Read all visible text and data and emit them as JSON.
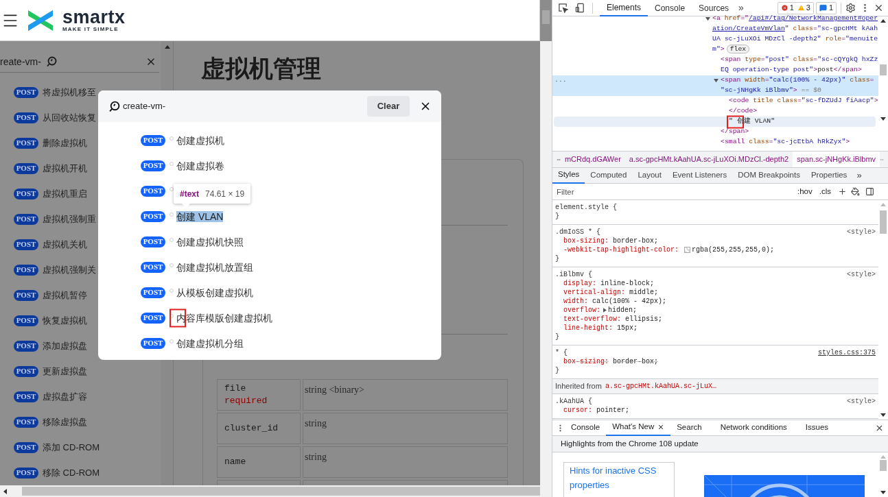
{
  "page": {
    "header": {
      "logo": {
        "name": "smartx",
        "tagline": "MAKE IT SIMPLE"
      }
    },
    "sidebar": {
      "search": {
        "value": "reate-vm-"
      },
      "items": [
        {
          "method": "POST",
          "label": "将虚拟机移至"
        },
        {
          "method": "POST",
          "label": "从回收站恢复"
        },
        {
          "method": "POST",
          "label": "删除虚拟机"
        },
        {
          "method": "POST",
          "label": "虚拟机开机"
        },
        {
          "method": "POST",
          "label": "虚拟机重启"
        },
        {
          "method": "POST",
          "label": "虚拟机强制重"
        },
        {
          "method": "POST",
          "label": "虚拟机关机"
        },
        {
          "method": "POST",
          "label": "虚拟机强制关"
        },
        {
          "method": "POST",
          "label": "虚拟机暂停"
        },
        {
          "method": "POST",
          "label": "恢复虚拟机"
        },
        {
          "method": "POST",
          "label": "添加虚拟盘"
        },
        {
          "method": "POST",
          "label": "更新虚拟盘"
        },
        {
          "method": "POST",
          "label": "虚拟盘扩容"
        },
        {
          "method": "POST",
          "label": "移除虚拟盘"
        },
        {
          "method": "POST",
          "label": "添加 CD-ROM"
        },
        {
          "method": "POST",
          "label": "移除 CD-ROM"
        }
      ]
    },
    "main": {
      "title": "虚拟机管理",
      "table": {
        "rows": [
          {
            "name": "file",
            "required": "required",
            "type": "string <binary>"
          },
          {
            "name": "cluster_id",
            "type": "string"
          },
          {
            "name": "name",
            "type": "string"
          }
        ]
      }
    },
    "search_modal": {
      "query": "create-vm-",
      "clear_button": "Clear",
      "results": [
        {
          "method": "POST",
          "label": "创建虚拟机",
          "highlighted": false,
          "marked": false
        },
        {
          "method": "POST",
          "label": "创建虚拟卷",
          "highlighted": false,
          "marked": false
        },
        {
          "method": "POST"
        },
        {
          "method": "POST",
          "label": "创建 VLAN",
          "highlighted": true,
          "marked": false
        },
        {
          "method": "POST",
          "label": "创建虚拟机快照",
          "highlighted": false,
          "marked": false
        },
        {
          "method": "POST",
          "label": "创建虚拟机放置组",
          "highlighted": false,
          "marked": false
        },
        {
          "method": "POST",
          "label": "从模板创建虚拟机",
          "highlighted": false,
          "marked": false
        },
        {
          "method": "POST",
          "label": "内容库模版创建虚拟机",
          "highlighted": false,
          "marked": true
        },
        {
          "method": "POST",
          "label": "创建虚拟机分组",
          "highlighted": false,
          "marked": false
        }
      ]
    },
    "tooltip": {
      "node": "#text",
      "size": "74.61 × 19"
    }
  },
  "devtools": {
    "toolbar": {
      "tabs": [
        {
          "label": "Elements",
          "selected": true
        },
        {
          "label": "Console",
          "selected": false
        },
        {
          "label": "Sources",
          "selected": false
        }
      ],
      "more": "»",
      "errors": "1",
      "warnings": "3",
      "messages": "1"
    },
    "elements": {
      "tree": [
        {
          "kind": "parent",
          "expanded": true,
          "selected": false,
          "hovered": false,
          "marked": false,
          "lines": [
            [
              {
                "kind": "tag",
                "text": "<a "
              },
              {
                "kind": "attr",
                "text": "href"
              },
              {
                "kind": "tag",
                "text": "=\""
              },
              {
                "kind": "link",
                "text": "/api#/tag/NetworkManagement#oper"
              }
            ],
            [
              {
                "kind": "link",
                "text": "ation/CreateVmVlan"
              },
              {
                "kind": "value",
                "text": "\" "
              },
              {
                "kind": "attr",
                "text": "class"
              },
              {
                "kind": "tag",
                "text": "="
              },
              {
                "kind": "value",
                "text": "\"sc-gpcHMt kAah"
              }
            ],
            [
              {
                "kind": "value",
                "text": "UA sc-jLuXOi MDzCl -depth2\" "
              },
              {
                "kind": "attr",
                "text": "role"
              },
              {
                "kind": "tag",
                "text": "="
              },
              {
                "kind": "value",
                "text": "\"menuite"
              }
            ],
            [
              {
                "kind": "value",
                "text": "m\""
              },
              {
                "kind": "tag",
                "text": ">"
              },
              {
                "kind": "badge",
                "text": "flex"
              }
            ]
          ],
          "children": [
            {
              "kind": "leaf",
              "selected": false,
              "hovered": false,
              "marked": false,
              "lines": [
                [
                  {
                    "kind": "tag",
                    "text": "<span "
                  },
                  {
                    "kind": "attr",
                    "text": "type"
                  },
                  {
                    "kind": "tag",
                    "text": "="
                  },
                  {
                    "kind": "value",
                    "text": "\"post\" "
                  },
                  {
                    "kind": "attr",
                    "text": "class"
                  },
                  {
                    "kind": "tag",
                    "text": "="
                  },
                  {
                    "kind": "value",
                    "text": "\"sc-cQYgkQ hxZz"
                  }
                ],
                [
                  {
                    "kind": "value",
                    "text": "EQ operation-type post\""
                  },
                  {
                    "kind": "tag",
                    "text": ">"
                  },
                  {
                    "kind": "text",
                    "text": "post"
                  },
                  {
                    "kind": "tag",
                    "text": "</span>"
                  }
                ]
              ]
            },
            {
              "kind": "parent",
              "expanded": true,
              "selected": true,
              "hovered": false,
              "marked": false,
              "gutter": "...",
              "lines": [
                [
                  {
                    "kind": "tag",
                    "text": "<span "
                  },
                  {
                    "kind": "attr",
                    "text": "width"
                  },
                  {
                    "kind": "tag",
                    "text": "="
                  },
                  {
                    "kind": "value",
                    "text": "\"calc(100% - 42px)\" "
                  },
                  {
                    "kind": "attr",
                    "text": "class"
                  },
                  {
                    "kind": "tag",
                    "text": "="
                  }
                ],
                [
                  {
                    "kind": "value",
                    "text": "\"sc-jNHgKk iBlbmv\""
                  },
                  {
                    "kind": "tag",
                    "text": ">"
                  },
                  {
                    "kind": "ref",
                    "text": " == $0"
                  }
                ]
              ],
              "children": [
                {
                  "kind": "leaf",
                  "selected": false,
                  "hovered": false,
                  "marked": false,
                  "lines": [
                    [
                      {
                        "kind": "tag",
                        "text": "<code "
                      },
                      {
                        "kind": "attr",
                        "text": "title "
                      },
                      {
                        "kind": "attr",
                        "text": "class"
                      },
                      {
                        "kind": "tag",
                        "text": "="
                      },
                      {
                        "kind": "value",
                        "text": "\"sc-fDZUdJ fiAacp\""
                      },
                      {
                        "kind": "tag",
                        "text": ">"
                      }
                    ],
                    [
                      {
                        "kind": "tag",
                        "text": "</code>"
                      }
                    ]
                  ]
                },
                {
                  "kind": "leaf",
                  "selected": false,
                  "hovered": true,
                  "marked": true,
                  "lines": [
                    [
                      {
                        "kind": "text",
                        "text": "\" 创建 VLAN\""
                      }
                    ]
                  ]
                }
              ],
              "closing": [
                [
                  {
                    "kind": "tag",
                    "text": "</span>"
                  }
                ]
              ]
            },
            {
              "kind": "leaf",
              "selected": false,
              "hovered": false,
              "marked": false,
              "lines": [
                [
                  {
                    "kind": "tag",
                    "text": "<small "
                  },
                  {
                    "kind": "attr",
                    "text": "class"
                  },
                  {
                    "kind": "tag",
                    "text": "="
                  },
                  {
                    "kind": "value",
                    "text": "\"sc-jcEtbA hRkZyx\""
                  },
                  {
                    "kind": "tag",
                    "text": ">"
                  }
                ]
              ]
            }
          ]
        }
      ]
    },
    "breadcrumbs": [
      {
        "label": "mCRdq.dGAWer",
        "selected": false
      },
      {
        "label": "a.sc-gpcHMt.kAahUA.sc-jLuXOi.MDzCl.-depth2",
        "selected": false
      },
      {
        "label": "span.sc-jNHgKk.iBlbmv",
        "selected": true
      }
    ],
    "styles_tabs": [
      {
        "label": "Styles",
        "selected": true
      },
      {
        "label": "Computed",
        "selected": false
      },
      {
        "label": "Layout",
        "selected": false
      },
      {
        "label": "Event Listeners",
        "selected": false
      },
      {
        "label": "DOM Breakpoints",
        "selected": false
      },
      {
        "label": "Properties",
        "selected": false
      }
    ],
    "styles_more": "»",
    "filter": {
      "placeholder": "Filter",
      "hov": ":hov",
      "cls": ".cls"
    },
    "rules": [
      {
        "kind": "rule",
        "selector": "element.style {",
        "close": "}"
      },
      {
        "kind": "rule",
        "selector": ".dmIoSS * {",
        "source": {
          "text": "<style>",
          "link": false
        },
        "declarations": [
          {
            "kind": "plain",
            "property": "box-sizing:",
            "value": "border-box;",
            "overridden": false
          },
          {
            "kind": "color",
            "property": "-webkit-tap-highlight-color:",
            "value": "rgba(255,255,255,0);",
            "overridden": false
          }
        ],
        "close": "}"
      },
      {
        "kind": "rule",
        "selector": ".iBlbmv {",
        "source": {
          "text": "<style>",
          "link": false
        },
        "declarations": [
          {
            "kind": "plain",
            "property": "display:",
            "value": "inline-block;",
            "overridden": false
          },
          {
            "kind": "plain",
            "property": "vertical-align:",
            "value": "middle;",
            "overridden": false
          },
          {
            "kind": "plain",
            "property": "width:",
            "value": "calc(100% - 42px);",
            "overridden": false
          },
          {
            "kind": "expandable",
            "property": "overflow:",
            "value": "hidden;",
            "overridden": false
          },
          {
            "kind": "plain",
            "property": "text-overflow:",
            "value": "ellipsis;",
            "overridden": false
          },
          {
            "kind": "plain",
            "property": "line-height:",
            "value": "15px;",
            "overridden": false
          }
        ],
        "close": "}"
      },
      {
        "kind": "rule",
        "selector": "* {",
        "source": {
          "text": "styles.css:375",
          "link": true
        },
        "declarations": [
          {
            "kind": "plain",
            "property": "box-sizing:",
            "value": "border-box;",
            "overridden": true
          }
        ],
        "close": "}"
      },
      {
        "kind": "inherited",
        "label": "Inherited from",
        "element": "a.sc-gpcHMt.kAahUA.sc-jLuX…"
      },
      {
        "kind": "rule",
        "selector": ".kAahUA {",
        "source": {
          "text": "<style>",
          "link": false
        },
        "declarations": [
          {
            "kind": "plain",
            "property": "cursor:",
            "value": "pointer;",
            "overridden": false
          }
        ]
      }
    ],
    "drawer": {
      "tabs": [
        {
          "label": "Console",
          "selected": false,
          "closable": false
        },
        {
          "label": "What's New",
          "selected": true,
          "closable": true
        },
        {
          "label": "Search",
          "selected": false,
          "closable": false
        },
        {
          "label": "Network conditions",
          "selected": false,
          "closable": false
        },
        {
          "label": "Issues",
          "selected": false,
          "closable": false
        }
      ],
      "heading": "Highlights from the Chrome 108 update",
      "card": {
        "title": "Hints for inactive CSS properties"
      }
    }
  }
}
